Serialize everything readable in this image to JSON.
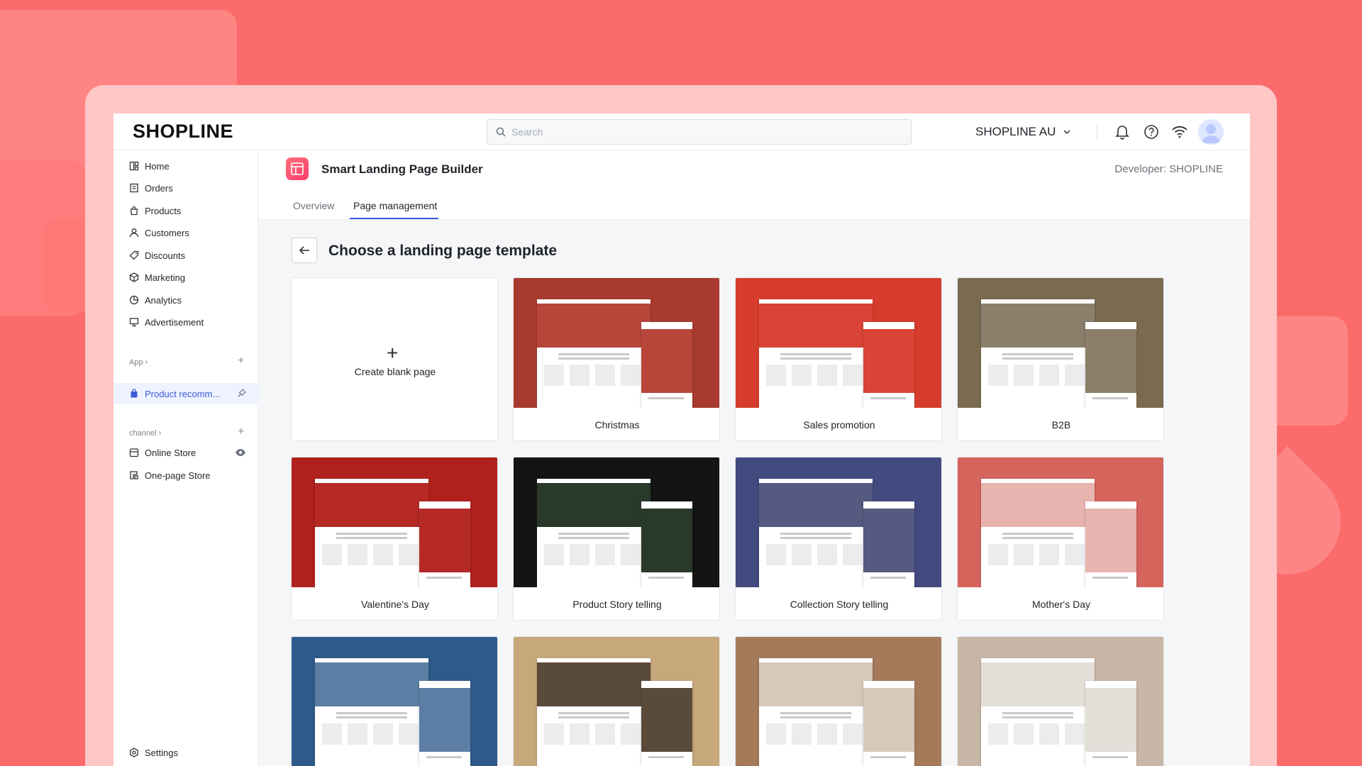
{
  "brand": {
    "logo_text": "SHOPLINE"
  },
  "search": {
    "placeholder": "Search"
  },
  "store": {
    "name": "SHOPLINE AU"
  },
  "sidebar": {
    "items": [
      {
        "label": "Home"
      },
      {
        "label": "Orders"
      },
      {
        "label": "Products"
      },
      {
        "label": "Customers"
      },
      {
        "label": "Discounts"
      },
      {
        "label": "Marketing"
      },
      {
        "label": "Analytics"
      },
      {
        "label": "Advertisement"
      }
    ],
    "app_section": "App",
    "app_item": "Product recomm...",
    "channel_section": "channel",
    "channel_items": [
      {
        "label": "Online Store"
      },
      {
        "label": "One-page Store"
      }
    ],
    "settings": "Settings"
  },
  "header": {
    "app_title": "Smart Landing Page Builder",
    "developer_label": "Developer:",
    "developer_name": "SHOPLINE",
    "tabs": [
      {
        "label": "Overview"
      },
      {
        "label": "Page management"
      }
    ]
  },
  "main": {
    "title": "Choose a landing page template",
    "blank_label": "Create blank page",
    "templates": [
      {
        "label": "Christmas",
        "color": "#a83a2f"
      },
      {
        "label": "Sales promotion",
        "color": "#d63c2c"
      },
      {
        "label": "B2B",
        "color": "#7a6a50"
      },
      {
        "label": "Valentine's Day",
        "color": "#b0201c"
      },
      {
        "label": "Product Story telling",
        "color": "#141414"
      },
      {
        "label": "Collection Story telling",
        "color": "#434a80"
      },
      {
        "label": "Mother's Day",
        "color": "#d5645c"
      },
      {
        "label": "",
        "color": "#2e5a8a"
      },
      {
        "label": "",
        "color": "#c6a87a"
      },
      {
        "label": "",
        "color": "#a57a5b"
      },
      {
        "label": "",
        "color": "#c8b6a6"
      }
    ]
  },
  "colors": {
    "accent": "#3b5bdb",
    "background": "#fb6b6b"
  }
}
